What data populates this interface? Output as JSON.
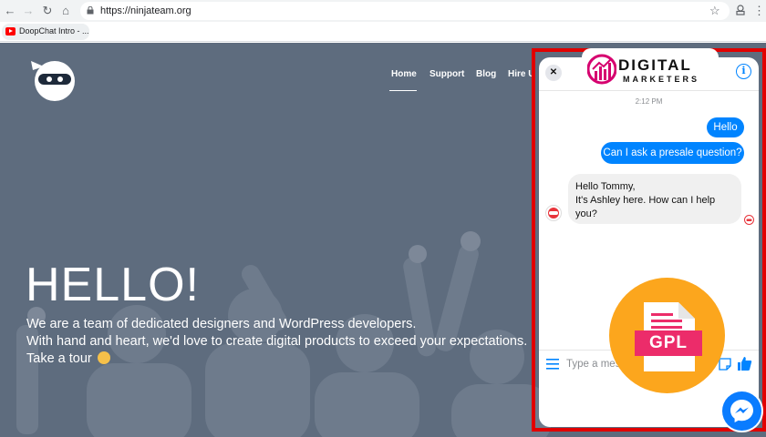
{
  "browser": {
    "url": "https://ninjateam.org",
    "bookmark_label": "DoopChat Intro - ..."
  },
  "site": {
    "nav": [
      "Home",
      "Support",
      "Blog",
      "Hire U"
    ],
    "hero_title": "HELLO!",
    "hero_lines": [
      "We are a team of dedicated designers and WordPress developers.",
      "With hand and heart, we'd love to create digital products to exceed your expectations.",
      "Take a tour"
    ]
  },
  "chat": {
    "brand_top": "DIGITAL",
    "brand_bottom": "MARKETERS",
    "time": "2:12 PM",
    "messages_out": [
      "Hello",
      "Can I ask a presale question?"
    ],
    "message_in_lines": [
      "Hello Tommy,",
      "It's Ashley here. How can I help",
      "you?"
    ],
    "input_placeholder": "Type a message...",
    "info_label": "i",
    "close_label": "✕"
  },
  "badge": {
    "label": "GPL"
  },
  "colors": {
    "site_bg": "#5e6c7e",
    "frame_red": "#e10000",
    "messenger_blue": "#0084ff",
    "badge_orange": "#fca61d",
    "badge_pink": "#ec2c6a",
    "brand_magenta": "#d6006f"
  }
}
